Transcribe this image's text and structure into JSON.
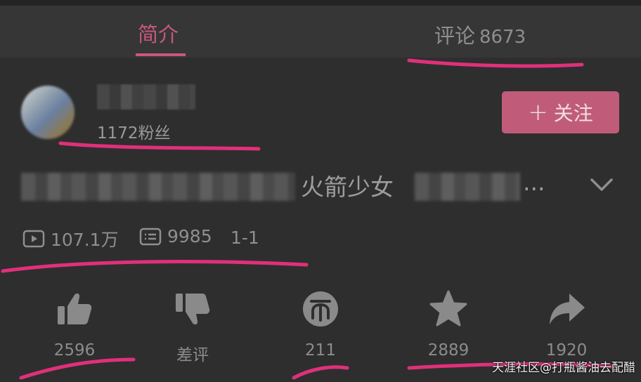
{
  "tabs": {
    "intro_label": "简介",
    "comments_label": "评论",
    "comments_count": "8673"
  },
  "uploader": {
    "fans": "1172粉丝",
    "follow_plus": "+",
    "follow_label": "关注"
  },
  "video": {
    "title_visible": "火箭少女",
    "title_ellipsis": "...",
    "views": "107.1万",
    "danmaku": "9985",
    "episode": "1-1"
  },
  "actions": {
    "like": "2596",
    "dislike": "差评",
    "coin": "211",
    "favorite": "2889",
    "share": "1920"
  },
  "watermark": "天涯社区@打瓶酱油去配醋",
  "colors": {
    "accent": "#c8587a",
    "background": "#2e2e2e",
    "annotation": "#e0307a"
  }
}
